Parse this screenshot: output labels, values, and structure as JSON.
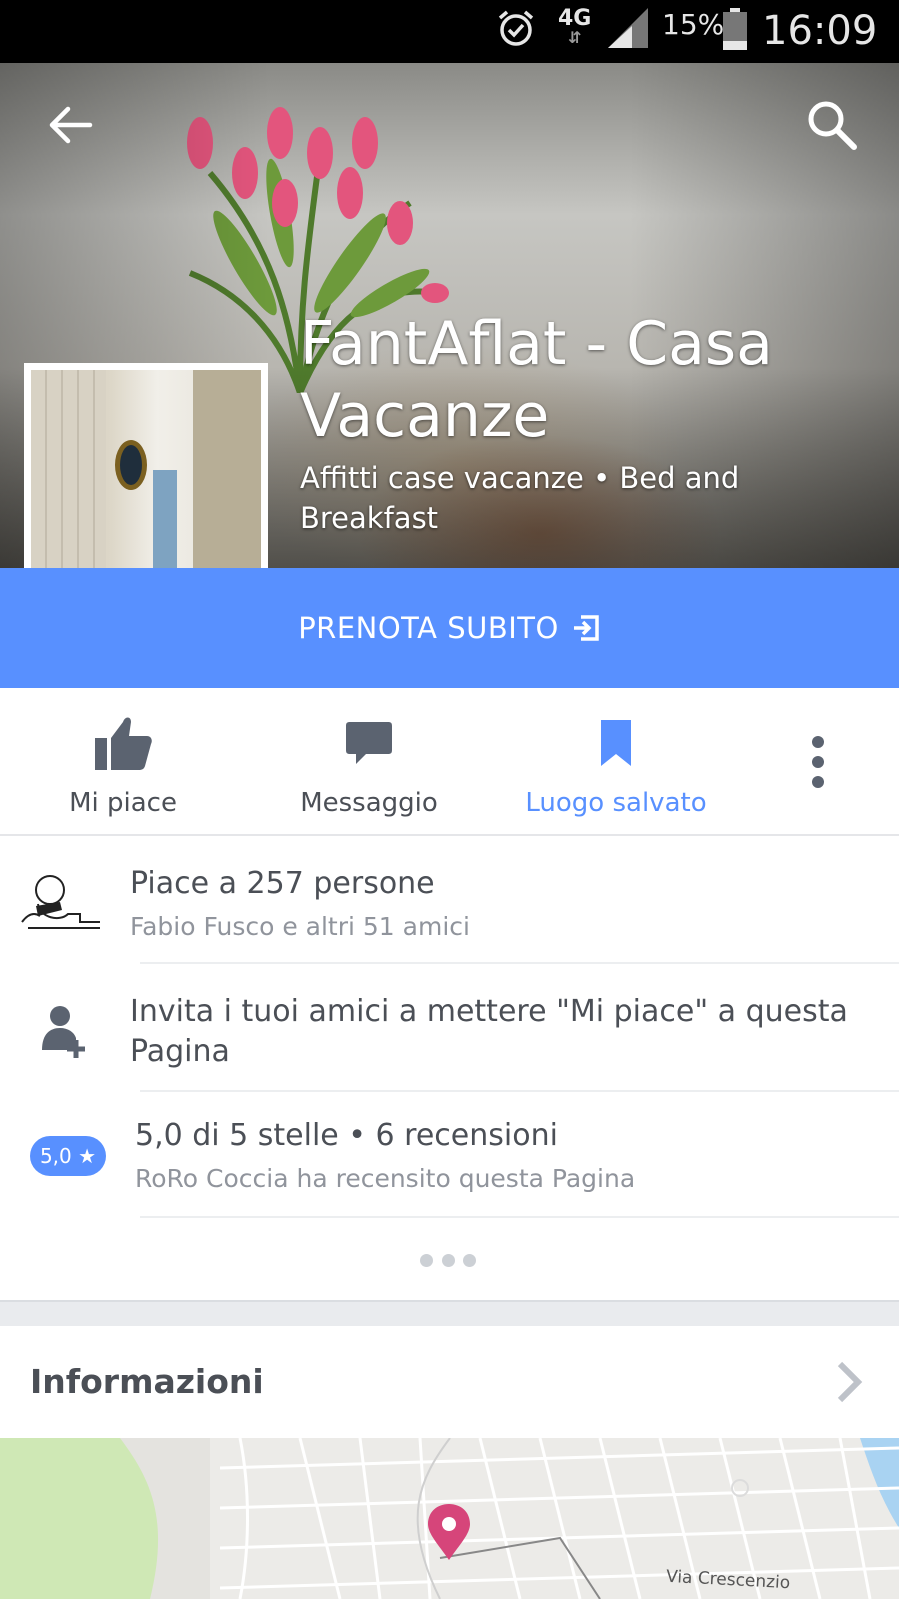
{
  "status_bar": {
    "network": "4G",
    "battery_percent": "15%",
    "time": "16:09"
  },
  "page": {
    "title": "FantAflat - Casa Vacanze",
    "category": "Affitti case vacanze • Bed and Breakfast"
  },
  "cta": {
    "label": "PRENOTA SUBITO"
  },
  "actions": [
    {
      "label": "Mi piace",
      "icon": "thumbs-up-icon"
    },
    {
      "label": "Messaggio",
      "icon": "message-icon"
    },
    {
      "label": "Luogo salvato",
      "icon": "bookmark-icon",
      "active": true
    }
  ],
  "likes": {
    "title": "Piace a 257 persone",
    "subtitle": "Fabio Fusco e altri 51 amici"
  },
  "invite": {
    "text": "Invita i tuoi amici a mettere \"Mi piace\" a questa Pagina"
  },
  "reviews": {
    "badge": "5,0 ★",
    "title": "5,0 di 5 stelle • 6 recensioni",
    "subtitle": "RoRo Coccia ha recensito questa Pagina"
  },
  "info": {
    "title": "Informazioni"
  },
  "map": {
    "street": "Via Crescenzio"
  },
  "colors": {
    "accent": "#5890ff",
    "text_primary": "#4b4f56",
    "text_secondary": "#90949c",
    "map_pin": "#d6457a"
  }
}
